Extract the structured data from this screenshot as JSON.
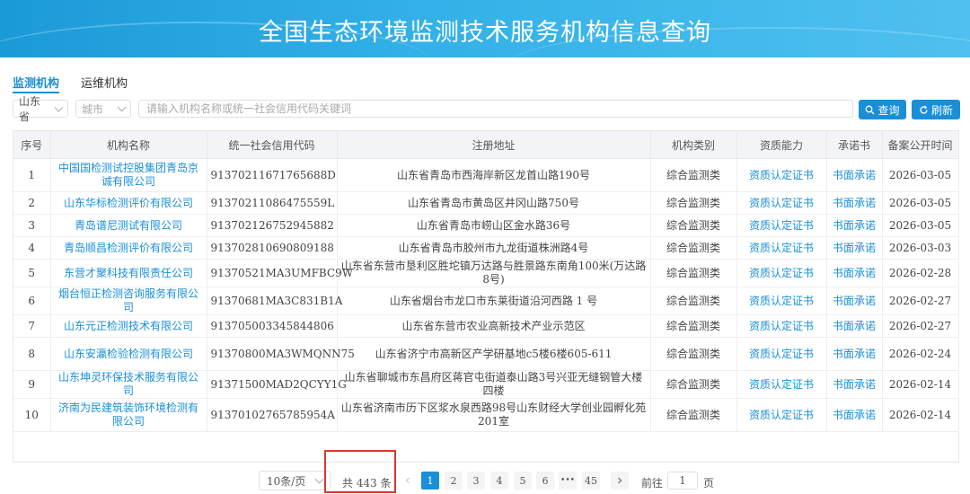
{
  "header": {
    "title": "全国生态环境监测技术服务机构信息查询"
  },
  "tabs": [
    {
      "label": "监测机构",
      "active": true
    },
    {
      "label": "运维机构",
      "active": false
    }
  ],
  "filters": {
    "province": "山东省",
    "city_placeholder": "城市",
    "search_placeholder": "请输入机构名称或统一社会信用代码关键词",
    "query_label": "查询",
    "refresh_label": "刷新"
  },
  "table": {
    "columns": [
      "序号",
      "机构名称",
      "统一社会信用代码",
      "注册地址",
      "机构类别",
      "资质能力",
      "承诺书",
      "备案公开时间"
    ],
    "rows": [
      {
        "no": "1",
        "name": "中国国检测试控股集团青岛京诚有限公司",
        "code": "91370211671765688D",
        "address": "山东省青岛市西海岸新区龙首山路190号",
        "category": "综合监测类",
        "qualification": "资质认定证书",
        "commitment": "书面承诺",
        "date": "2026-03-05"
      },
      {
        "no": "2",
        "name": "山东华标检测评价有限公司",
        "code": "91370211086475559L",
        "address": "山东省青岛市黄岛区井冈山路750号",
        "category": "综合监测类",
        "qualification": "资质认定证书",
        "commitment": "书面承诺",
        "date": "2026-03-05"
      },
      {
        "no": "3",
        "name": "青岛谱尼测试有限公司",
        "code": "913702126752945882",
        "address": "山东省青岛市崂山区金水路36号",
        "category": "综合监测类",
        "qualification": "资质认定证书",
        "commitment": "书面承诺",
        "date": "2026-03-05"
      },
      {
        "no": "4",
        "name": "青岛顺昌检测评价有限公司",
        "code": "913702810690809188",
        "address": "山东省青岛市胶州市九龙街道株洲路4号",
        "category": "综合监测类",
        "qualification": "资质认定证书",
        "commitment": "书面承诺",
        "date": "2026-03-03"
      },
      {
        "no": "5",
        "name": "东营才聚科技有限责任公司",
        "code": "91370521MA3UMFBC9W",
        "address": "山东省东营市垦利区胜坨镇万达路与胜景路东南角100米(万达路8号)",
        "category": "综合监测类",
        "qualification": "资质认定证书",
        "commitment": "书面承诺",
        "date": "2026-02-28"
      },
      {
        "no": "6",
        "name": "烟台恒正检测咨询服务有限公司",
        "code": "91370681MA3C831B1A",
        "address": "山东省烟台市龙口市东莱街道沿河西路 1 号",
        "category": "综合监测类",
        "qualification": "资质认定证书",
        "commitment": "书面承诺",
        "date": "2026-02-27"
      },
      {
        "no": "7",
        "name": "山东元正检测技术有限公司",
        "code": "913705003345844806",
        "address": "山东省东营市农业高新技术产业示范区",
        "category": "综合监测类",
        "qualification": "资质认定证书",
        "commitment": "书面承诺",
        "date": "2026-02-27"
      },
      {
        "no": "8",
        "name": "山东安瀛检验检测有限公司",
        "code": "91370800MA3WMQNN75",
        "address": "山东省济宁市高新区产学研基地c5楼6楼605-611",
        "category": "综合监测类",
        "qualification": "资质认定证书",
        "commitment": "书面承诺",
        "date": "2026-02-24"
      },
      {
        "no": "9",
        "name": "山东坤灵环保技术服务有限公司",
        "code": "91371500MAD2QCYY1G",
        "address": "山东省聊城市东昌府区蒋官屯街道泰山路3号兴亚无缝钢管大楼四楼",
        "category": "综合监测类",
        "qualification": "资质认定证书",
        "commitment": "书面承诺",
        "date": "2026-02-14"
      },
      {
        "no": "10",
        "name": "济南为民建筑装饰环境检测有限公司",
        "code": "91370102765785954A",
        "address": "山东省济南市历下区浆水泉西路98号山东财经大学创业园孵化苑201室",
        "category": "综合监测类",
        "qualification": "资质认定证书",
        "commitment": "书面承诺",
        "date": "2026-02-14"
      }
    ]
  },
  "pagination": {
    "page_size": "10条/页",
    "total": "共 443 条",
    "pages": [
      "1",
      "2",
      "3",
      "4",
      "5",
      "6",
      "•••",
      "45"
    ],
    "current": "1",
    "goto_label": "前往",
    "goto_value": "1",
    "page_suffix": "页"
  },
  "colors": {
    "accent": "#1a8fd8",
    "highlight_box": "#d9372c"
  }
}
